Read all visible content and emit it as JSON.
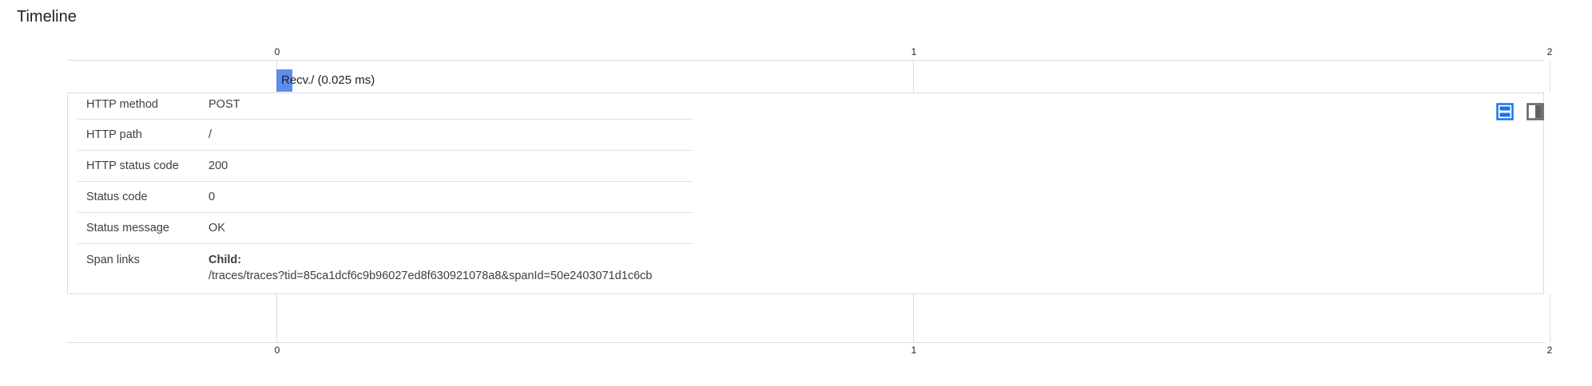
{
  "page": {
    "title": "Timeline"
  },
  "axis": {
    "ticks": [
      "0",
      "1",
      "2"
    ]
  },
  "span": {
    "label": "Recv./ (0.025 ms)",
    "color": "#5b8def"
  },
  "details": {
    "attributes": [
      {
        "key": "HTTP method",
        "value": "POST"
      },
      {
        "key": "HTTP path",
        "value": "/"
      },
      {
        "key": "HTTP status code",
        "value": "200"
      },
      {
        "key": "Status code",
        "value": "0"
      },
      {
        "key": "Status message",
        "value": "OK"
      }
    ],
    "span_links": {
      "key": "Span links",
      "label": "Child:",
      "url": "/traces/traces?tid=85ca1dcf6c9b96027ed8f630921078a8&spanId=50e2403071d1c6cb"
    },
    "layout_buttons": {
      "stacked_icon": "view-stacked-icon",
      "side_icon": "view-side-panel-icon",
      "active_color": "#1a73e8",
      "inactive_color": "#5f6368"
    }
  }
}
